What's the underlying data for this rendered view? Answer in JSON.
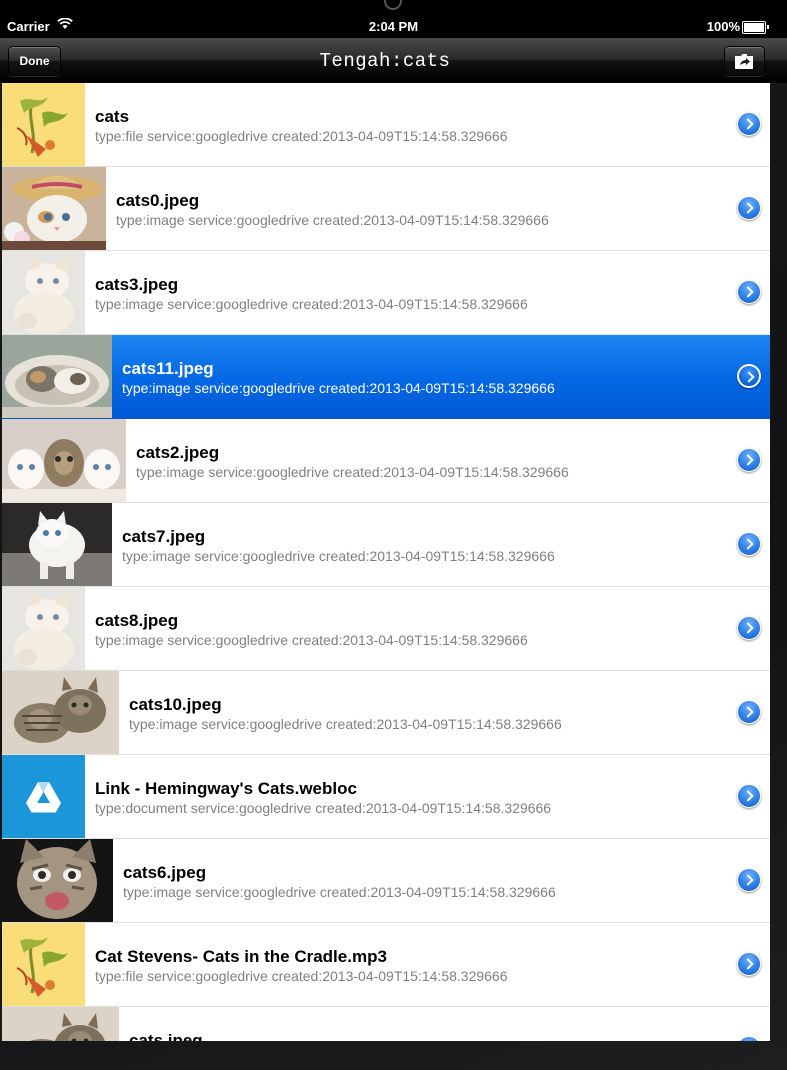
{
  "status_bar": {
    "carrier": "Carrier",
    "time": "2:04 PM",
    "battery": "100%"
  },
  "nav": {
    "title": "Tengah:cats",
    "done_label": "Done",
    "folder_icon": "folder-share-icon"
  },
  "rows": [
    {
      "name": "cats",
      "meta": "type:file service:googledrive created:2013-04-09T15:14:58.329666",
      "thumb": "file-thumbnail",
      "selected": false
    },
    {
      "name": "cats0.jpeg",
      "meta": "type:image service:googledrive created:2013-04-09T15:14:58.329666",
      "thumb": "kitten-hat-photo",
      "selected": false
    },
    {
      "name": "cats3.jpeg",
      "meta": "type:image service:googledrive created:2013-04-09T15:14:58.329666",
      "thumb": "white-kitten-photo",
      "selected": false
    },
    {
      "name": "cats11.jpeg",
      "meta": "type:image service:googledrive created:2013-04-09T15:14:58.329666",
      "thumb": "cats-in-basket-photo",
      "selected": true
    },
    {
      "name": "cats2.jpeg",
      "meta": "type:image service:googledrive created:2013-04-09T15:14:58.329666",
      "thumb": "three-kittens-photo",
      "selected": false
    },
    {
      "name": "cats7.jpeg",
      "meta": "type:image service:googledrive created:2013-04-09T15:14:58.329666",
      "thumb": "white-kitten-walking-photo",
      "selected": false
    },
    {
      "name": "cats8.jpeg",
      "meta": "type:image service:googledrive created:2013-04-09T15:14:58.329666",
      "thumb": "white-kitten-photo",
      "selected": false
    },
    {
      "name": "cats10.jpeg",
      "meta": "type:image service:googledrive created:2013-04-09T15:14:58.329666",
      "thumb": "tabby-kittens-photo",
      "selected": false
    },
    {
      "name": "Link - Hemingway's Cats.webloc",
      "meta": "type:document service:googledrive created:2013-04-09T15:14:58.329666",
      "thumb": "google-drive-icon",
      "selected": false
    },
    {
      "name": "cats6.jpeg",
      "meta": "type:image service:googledrive created:2013-04-09T15:14:58.329666",
      "thumb": "meowing-kitten-photo",
      "selected": false
    },
    {
      "name": "Cat Stevens- Cats in the Cradle.mp3",
      "meta": "type:file service:googledrive created:2013-04-09T15:14:58.329666",
      "thumb": "file-thumbnail",
      "selected": false
    },
    {
      "name": "cats.jpeg",
      "meta": "",
      "thumb": "tabby-kittens-photo",
      "selected": false
    }
  ],
  "colors": {
    "selection": "#0569e4",
    "nav_bar": "#1c1c1c",
    "disclosure": "#2f7fe6"
  }
}
